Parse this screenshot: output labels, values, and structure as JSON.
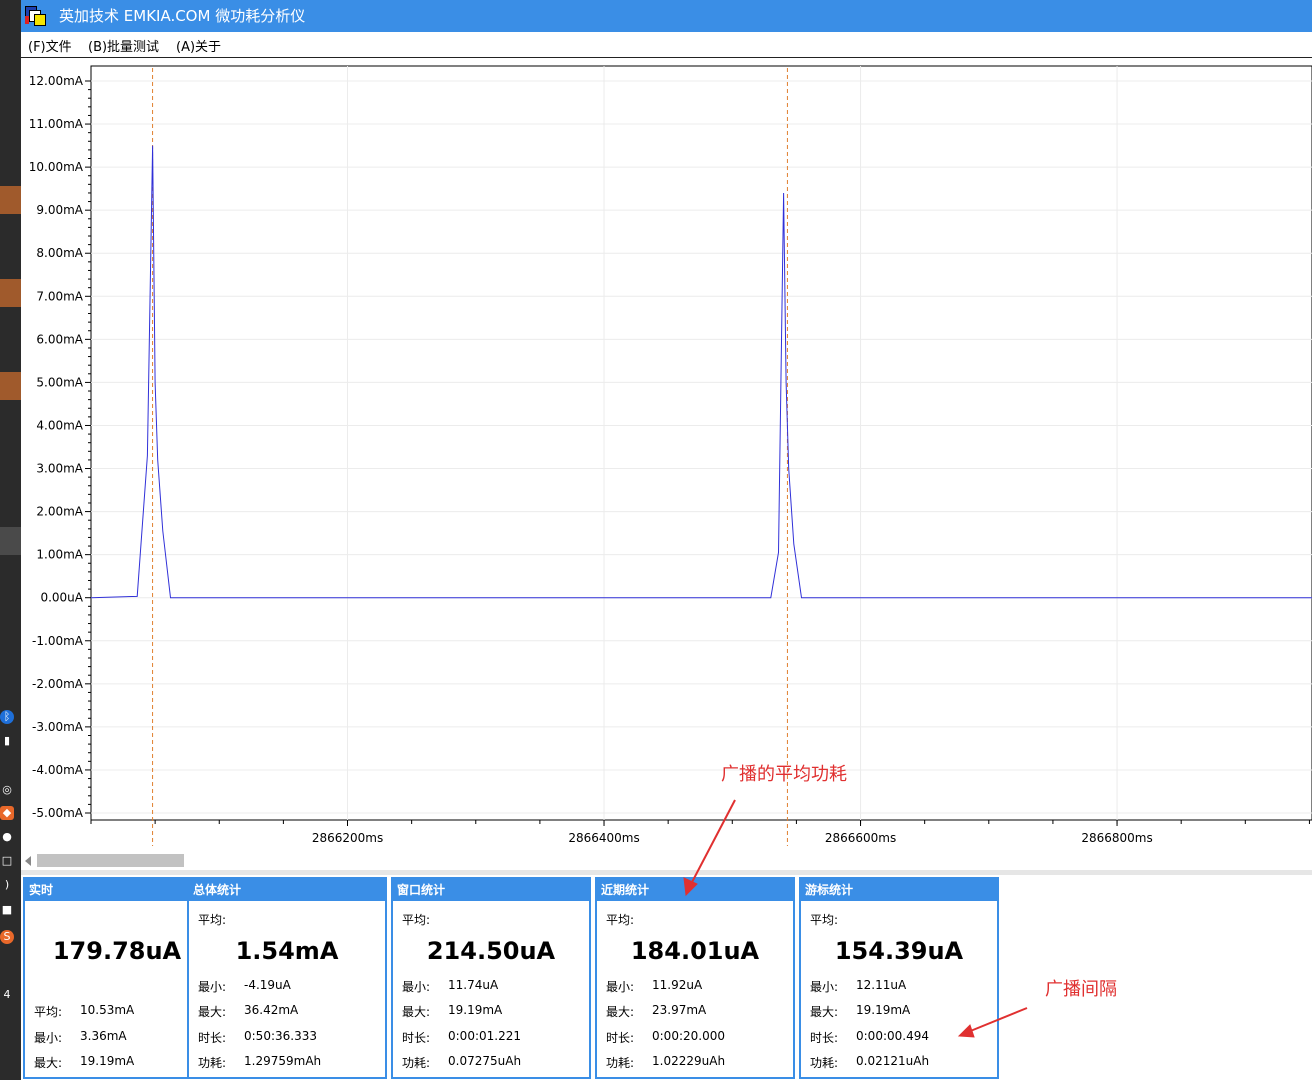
{
  "window": {
    "title": "英加技术 EMKIA.COM 微功耗分析仪"
  },
  "menu": {
    "items": [
      "(F)文件",
      "(B)批量测试",
      "(A)关于"
    ]
  },
  "chart_data": {
    "type": "line",
    "title": "",
    "xlabel": "",
    "ylabel": "",
    "y_ticks": [
      "12.00mA",
      "11.00mA",
      "10.00mA",
      "9.00mA",
      "8.00mA",
      "7.00mA",
      "6.00mA",
      "5.00mA",
      "4.00mA",
      "3.00mA",
      "2.00mA",
      "1.00mA",
      "0.00uA",
      "-1.00mA",
      "-2.00mA",
      "-3.00mA",
      "-4.00mA",
      "-5.00mA"
    ],
    "x_ticks": [
      "2866200ms",
      "2866400ms",
      "2866600ms",
      "2866800ms"
    ],
    "ylim": [
      -5.0,
      12.0
    ],
    "xlim": [
      2866000,
      2866952
    ],
    "grid": true,
    "series": [
      {
        "color": "#3030d8",
        "x": [
          2866000,
          2866036,
          2866044,
          2866048,
          2866050,
          2866052,
          2866056,
          2866062,
          2866100,
          2866530,
          2866536,
          2866540,
          2866542,
          2866544,
          2866548,
          2866554,
          2866952
        ],
        "y": [
          0.0,
          0.03,
          3.3,
          10.5,
          5.0,
          3.2,
          1.55,
          0.0,
          0.0,
          0.0,
          1.05,
          9.4,
          5.0,
          3.0,
          1.25,
          0.0,
          0.0
        ]
      }
    ],
    "cursors": [
      {
        "x": 2866048,
        "color": "#e08030",
        "style": "dashed"
      },
      {
        "x": 2866543,
        "color": "#e08030",
        "style": "dashed"
      }
    ]
  },
  "panels": [
    {
      "title": "实时",
      "big": "179.78uA",
      "rows": [
        {
          "label": "平均:",
          "value": "10.53mA"
        },
        {
          "label": "最小:",
          "value": "3.36mA"
        },
        {
          "label": "最大:",
          "value": "19.19mA"
        }
      ]
    },
    {
      "title": "总体统计",
      "avg_label": "平均:",
      "big": "1.54mA",
      "rows": [
        {
          "label": "最小:",
          "value": "-4.19uA"
        },
        {
          "label": "最大:",
          "value": "36.42mA"
        },
        {
          "label": "时长:",
          "value": "0:50:36.333"
        },
        {
          "label": "功耗:",
          "value": "1.29759mAh"
        }
      ]
    },
    {
      "title": "窗口统计",
      "avg_label": "平均:",
      "big": "214.50uA",
      "rows": [
        {
          "label": "最小:",
          "value": "11.74uA"
        },
        {
          "label": "最大:",
          "value": "19.19mA"
        },
        {
          "label": "时长:",
          "value": "0:00:01.221"
        },
        {
          "label": "功耗:",
          "value": "0.07275uAh"
        }
      ]
    },
    {
      "title": "近期统计",
      "avg_label": "平均:",
      "big": "184.01uA",
      "rows": [
        {
          "label": "最小:",
          "value": "11.92uA"
        },
        {
          "label": "最大:",
          "value": "23.97mA"
        },
        {
          "label": "时长:",
          "value": "0:00:20.000"
        },
        {
          "label": "功耗:",
          "value": "1.02229uAh"
        }
      ]
    },
    {
      "title": "游标统计",
      "avg_label": "平均:",
      "big": "154.39uA",
      "rows": [
        {
          "label": "最小:",
          "value": "12.11uA"
        },
        {
          "label": "最大:",
          "value": "19.19mA"
        },
        {
          "label": "时长:",
          "value": "0:00:00.494"
        },
        {
          "label": "功耗:",
          "value": "0.02121uAh"
        }
      ]
    }
  ],
  "annotations": [
    {
      "text": "广播的平均功耗",
      "color": "#e03030"
    },
    {
      "text": "广播间隔",
      "color": "#e03030"
    }
  ],
  "side_strip": {
    "label": "4"
  }
}
